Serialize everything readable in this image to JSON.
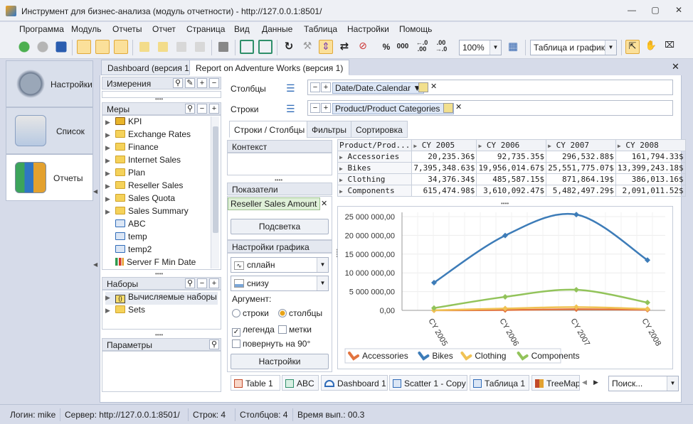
{
  "window": {
    "title": "Инструмент для бизнес-анализа (модуль отчетности) - http://127.0.0.1:8501/"
  },
  "menu": [
    "Программа",
    "Модуль",
    "Отчеты",
    "Отчет",
    "Страница",
    "Вид",
    "Данные",
    "Таблица",
    "Настройки",
    "Помощь"
  ],
  "toolbar": {
    "percent": "%",
    "thousands": "000",
    "dec_less": "←.0\n.00",
    "dec_more": ".00\n→.0",
    "zoom": "100%",
    "view_mode": "Таблица и график"
  },
  "nav": [
    {
      "label": "Настройки"
    },
    {
      "label": "Список"
    },
    {
      "label": "Отчеты"
    }
  ],
  "doc_tabs": [
    {
      "label": "Dashboard (версия 1)"
    },
    {
      "label": "Report on Adventure Works (версия 1)"
    }
  ],
  "panels": {
    "dimensions": {
      "title": "Измерения"
    },
    "measures": {
      "title": "Меры",
      "items": [
        {
          "label": "KPI",
          "kind": "kpi"
        },
        {
          "label": "Exchange Rates",
          "kind": "folder"
        },
        {
          "label": "Finance",
          "kind": "folder"
        },
        {
          "label": "Internet Sales",
          "kind": "folder"
        },
        {
          "label": "Plan",
          "kind": "folder"
        },
        {
          "label": "Reseller Sales",
          "kind": "folder"
        },
        {
          "label": "Sales Quota",
          "kind": "folder"
        },
        {
          "label": "Sales Summary",
          "kind": "folder"
        },
        {
          "label": "ABC",
          "kind": "calc"
        },
        {
          "label": "temp",
          "kind": "calc"
        },
        {
          "label": "temp2",
          "kind": "calc"
        },
        {
          "label": "Server F Min Date",
          "kind": "bars"
        }
      ]
    },
    "sets": {
      "title": "Наборы",
      "items": [
        {
          "label": "Вычисляемые наборы"
        },
        {
          "label": "Sets"
        }
      ]
    },
    "params": {
      "title": "Параметры"
    }
  },
  "axes": {
    "columns_label": "Столбцы",
    "columns_chip": "Date/Date.Calendar",
    "rows_label": "Строки",
    "rows_chip": "Product/Product Categories"
  },
  "subtabs": [
    "Строки / Столбцы",
    "Фильтры",
    "Сортировка"
  ],
  "context": {
    "title": "Контекст"
  },
  "indicators": {
    "title": "Показатели",
    "measure": "Reseller Sales Amount",
    "highlight_button": "Подсветка"
  },
  "chart_settings": {
    "title": "Настройки графика",
    "chart_kind": "сплайн",
    "legend_pos": "снизу",
    "argument_label": "Аргумент:",
    "arg_rows": "строки",
    "arg_cols": "столбцы",
    "legend": "легенда",
    "marks": "метки",
    "rotate": "повернуть на 90°",
    "settings_button": "Настройки"
  },
  "grid": {
    "corner": "Product/Prod...",
    "columns": [
      "CY 2005",
      "CY 2006",
      "CY 2007",
      "CY 2008"
    ],
    "rows": [
      {
        "label": "Accessories",
        "values": [
          "20,235.36$",
          "92,735.35$",
          "296,532.88$",
          "161,794.33$"
        ]
      },
      {
        "label": "Bikes",
        "values": [
          "7,395,348.63$",
          "19,956,014.67$",
          "25,551,775.07$",
          "13,399,243.18$"
        ]
      },
      {
        "label": "Clothing",
        "values": [
          "34,376.34$",
          "485,587.15$",
          "871,864.19$",
          "386,013.16$"
        ]
      },
      {
        "label": "Components",
        "values": [
          "615,474.98$",
          "3,610,092.47$",
          "5,482,497.29$",
          "2,091,011.52$"
        ]
      }
    ]
  },
  "chart_data": {
    "type": "line",
    "categories": [
      "CY 2005",
      "CY 2006",
      "CY 2007",
      "CY 2008"
    ],
    "series": [
      {
        "name": "Accessories",
        "color": "#e2743f",
        "values": [
          20235.36,
          92735.35,
          296532.88,
          161794.33
        ]
      },
      {
        "name": "Bikes",
        "color": "#3d7cb8",
        "values": [
          7395348.63,
          19956014.67,
          25551775.07,
          13399243.18
        ]
      },
      {
        "name": "Clothing",
        "color": "#f0c254",
        "values": [
          34376.34,
          485587.15,
          871864.19,
          386013.16
        ]
      },
      {
        "name": "Components",
        "color": "#92c35a",
        "values": [
          615474.98,
          3610092.47,
          5482497.29,
          2091011.52
        ]
      }
    ],
    "yticks": [
      "25 000 000,00",
      "20 000 000,00",
      "15 000 000,00",
      "10 000 000,00",
      "5 000 000,00",
      "0,00"
    ],
    "ylim": [
      0,
      25000000
    ],
    "legend": "bottom-left",
    "grid": true
  },
  "bottom_tabs": [
    {
      "label": "Table 1"
    },
    {
      "label": "ABC"
    },
    {
      "label": "Dashboard 1"
    },
    {
      "label": "Scatter 1 - Copy"
    },
    {
      "label": "Таблица 1"
    },
    {
      "label": "TreeMap"
    }
  ],
  "search": {
    "placeholder": "Поиск..."
  },
  "status": {
    "login": "Логин: mike",
    "server": "Сервер: http://127.0.0.1:8501/",
    "rows": "Строк: 4",
    "cols": "Столбцов: 4",
    "time": "Время вып.: 00.3"
  }
}
